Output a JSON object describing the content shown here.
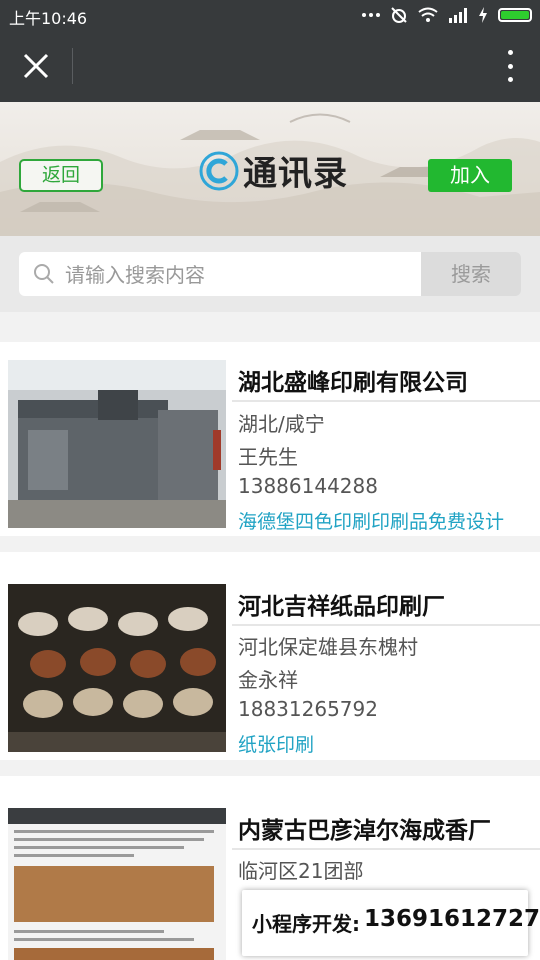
{
  "status_bar": {
    "time": "上午10:46"
  },
  "header": {
    "title": "通讯录",
    "back_label": "返回",
    "join_label": "加入"
  },
  "search": {
    "placeholder": "请输入搜索内容",
    "button_label": "搜索"
  },
  "listings": [
    {
      "company": "湖北盛峰印刷有限公司",
      "location": "湖北/咸宁",
      "contact": "王先生",
      "phone": "13886144288",
      "business": "海德堡四色印刷印刷品免费设计"
    },
    {
      "company": "河北吉祥纸品印刷厂",
      "location": "河北保定雄县东槐村",
      "contact": "金永祥",
      "phone": "18831265792",
      "business": "纸张印刷"
    },
    {
      "company": "内蒙古巴彦淖尔海成香厂",
      "location": "临河区21团部"
    }
  ],
  "promo": {
    "label": "小程序开发:",
    "phone": "13691612727"
  },
  "colors": {
    "accent_green": "#22b830",
    "link_blue": "#21a3c4",
    "bar_dark": "#373a3c"
  }
}
